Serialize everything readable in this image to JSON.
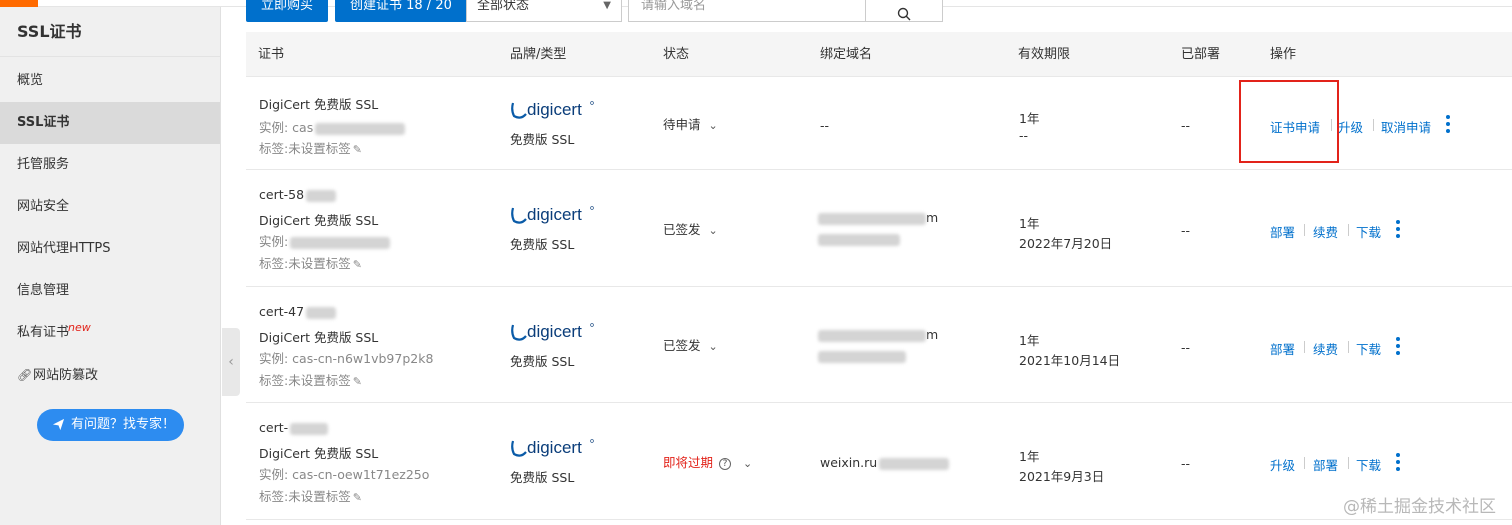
{
  "sidebar": {
    "title": "SSL证书",
    "items": [
      {
        "label": "概览"
      },
      {
        "label": "SSL证书"
      },
      {
        "label": "托管服务"
      },
      {
        "label": "网站安全"
      },
      {
        "label": "网站代理HTTPS"
      },
      {
        "label": "信息管理"
      },
      {
        "label": "私有证书",
        "badge": "new"
      },
      {
        "label": "网站防篡改"
      }
    ],
    "help_button": "有问题？找专家！"
  },
  "toolbar": {
    "buy_label": "立即购买",
    "create_label": "创建证书 18 / 20",
    "status_filter": "全部状态",
    "search_placeholder": "请输入域名"
  },
  "table": {
    "headers": {
      "cert": "证书",
      "brand": "品牌/类型",
      "status": "状态",
      "domain": "绑定域名",
      "validity": "有效期限",
      "deployed": "已部署",
      "actions": "操作"
    },
    "rows": [
      {
        "name": "",
        "product": "DigiCert 免费版 SSL",
        "instance": "实例: cas",
        "tag": "标签:未设置标签",
        "brand": "digicert",
        "type": "免费版 SSL",
        "status": "待申请",
        "domain": "--",
        "period": "1年",
        "expiry": "--",
        "deployed": "--",
        "actions": [
          "证书申请",
          "升级",
          "取消申请"
        ]
      },
      {
        "name": "cert-58",
        "product": "DigiCert 免费版 SSL",
        "instance": "实例:",
        "tag": "标签:未设置标签",
        "brand": "digicert",
        "type": "免费版 SSL",
        "status": "已签发",
        "domain": "m",
        "period": "1年",
        "expiry": "2022年7月20日",
        "deployed": "--",
        "actions": [
          "部署",
          "续费",
          "下载"
        ]
      },
      {
        "name": "cert-47",
        "product": "DigiCert 免费版 SSL",
        "instance": "实例: cas-cn-n6w1vb97p2k8",
        "tag": "标签:未设置标签",
        "brand": "digicert",
        "type": "免费版 SSL",
        "status": "已签发",
        "domain": "m",
        "period": "1年",
        "expiry": "2021年10月14日",
        "deployed": "--",
        "actions": [
          "部署",
          "续费",
          "下载"
        ]
      },
      {
        "name": "cert-",
        "product": "DigiCert 免费版 SSL",
        "instance": "实例: cas-cn-oew1t71ez25o",
        "tag": "标签:未设置标签",
        "brand": "digicert",
        "type": "免费版 SSL",
        "status": "即将过期",
        "domain": "weixin.ru",
        "period": "1年",
        "expiry": "2021年9月3日",
        "deployed": "--",
        "actions": [
          "升级",
          "部署",
          "下载"
        ]
      }
    ]
  },
  "colors": {
    "accent": "#0070cc",
    "warning": "#e2231a",
    "brand_orange": "#ff6a00"
  },
  "watermark": "@稀土掘金技术社区"
}
